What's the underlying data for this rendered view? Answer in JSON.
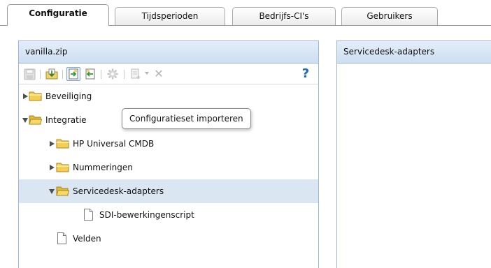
{
  "tabs": [
    {
      "label": "Configuratie",
      "active": true
    },
    {
      "label": "Tijdsperioden",
      "active": false
    },
    {
      "label": "Bedrijfs-CI's",
      "active": false
    },
    {
      "label": "Gebruikers",
      "active": false
    }
  ],
  "left_panel": {
    "title": "vanilla.zip",
    "toolbar_icons": [
      "save-icon",
      "export-icon",
      "import-config-icon",
      "import-icon",
      "gear-icon",
      "add-item-icon",
      "delete-icon",
      "help-icon"
    ],
    "tree": [
      {
        "label": "Beveiliging",
        "type": "folder",
        "state": "collapsed"
      },
      {
        "label": "Integratie",
        "type": "folder",
        "state": "expanded"
      },
      {
        "label": "HP Universal CMDB",
        "type": "folder",
        "state": "collapsed"
      },
      {
        "label": "Nummeringen",
        "type": "folder",
        "state": "collapsed"
      },
      {
        "label": "Servicedesk-adapters",
        "type": "folder",
        "state": "expanded",
        "selected": true
      },
      {
        "label": "SDI-bewerkingenscript",
        "type": "file"
      },
      {
        "label": "Velden",
        "type": "file"
      }
    ]
  },
  "right_panel": {
    "title": "Servicedesk-adapters"
  },
  "tooltip": {
    "text": "Configuratieset importeren"
  },
  "colors": {
    "panel_header": "#cddff2",
    "panel_border": "#9db8d6",
    "selection": "#dbe6f3",
    "folder": "#f6cf52",
    "help": "#1b67b8"
  }
}
